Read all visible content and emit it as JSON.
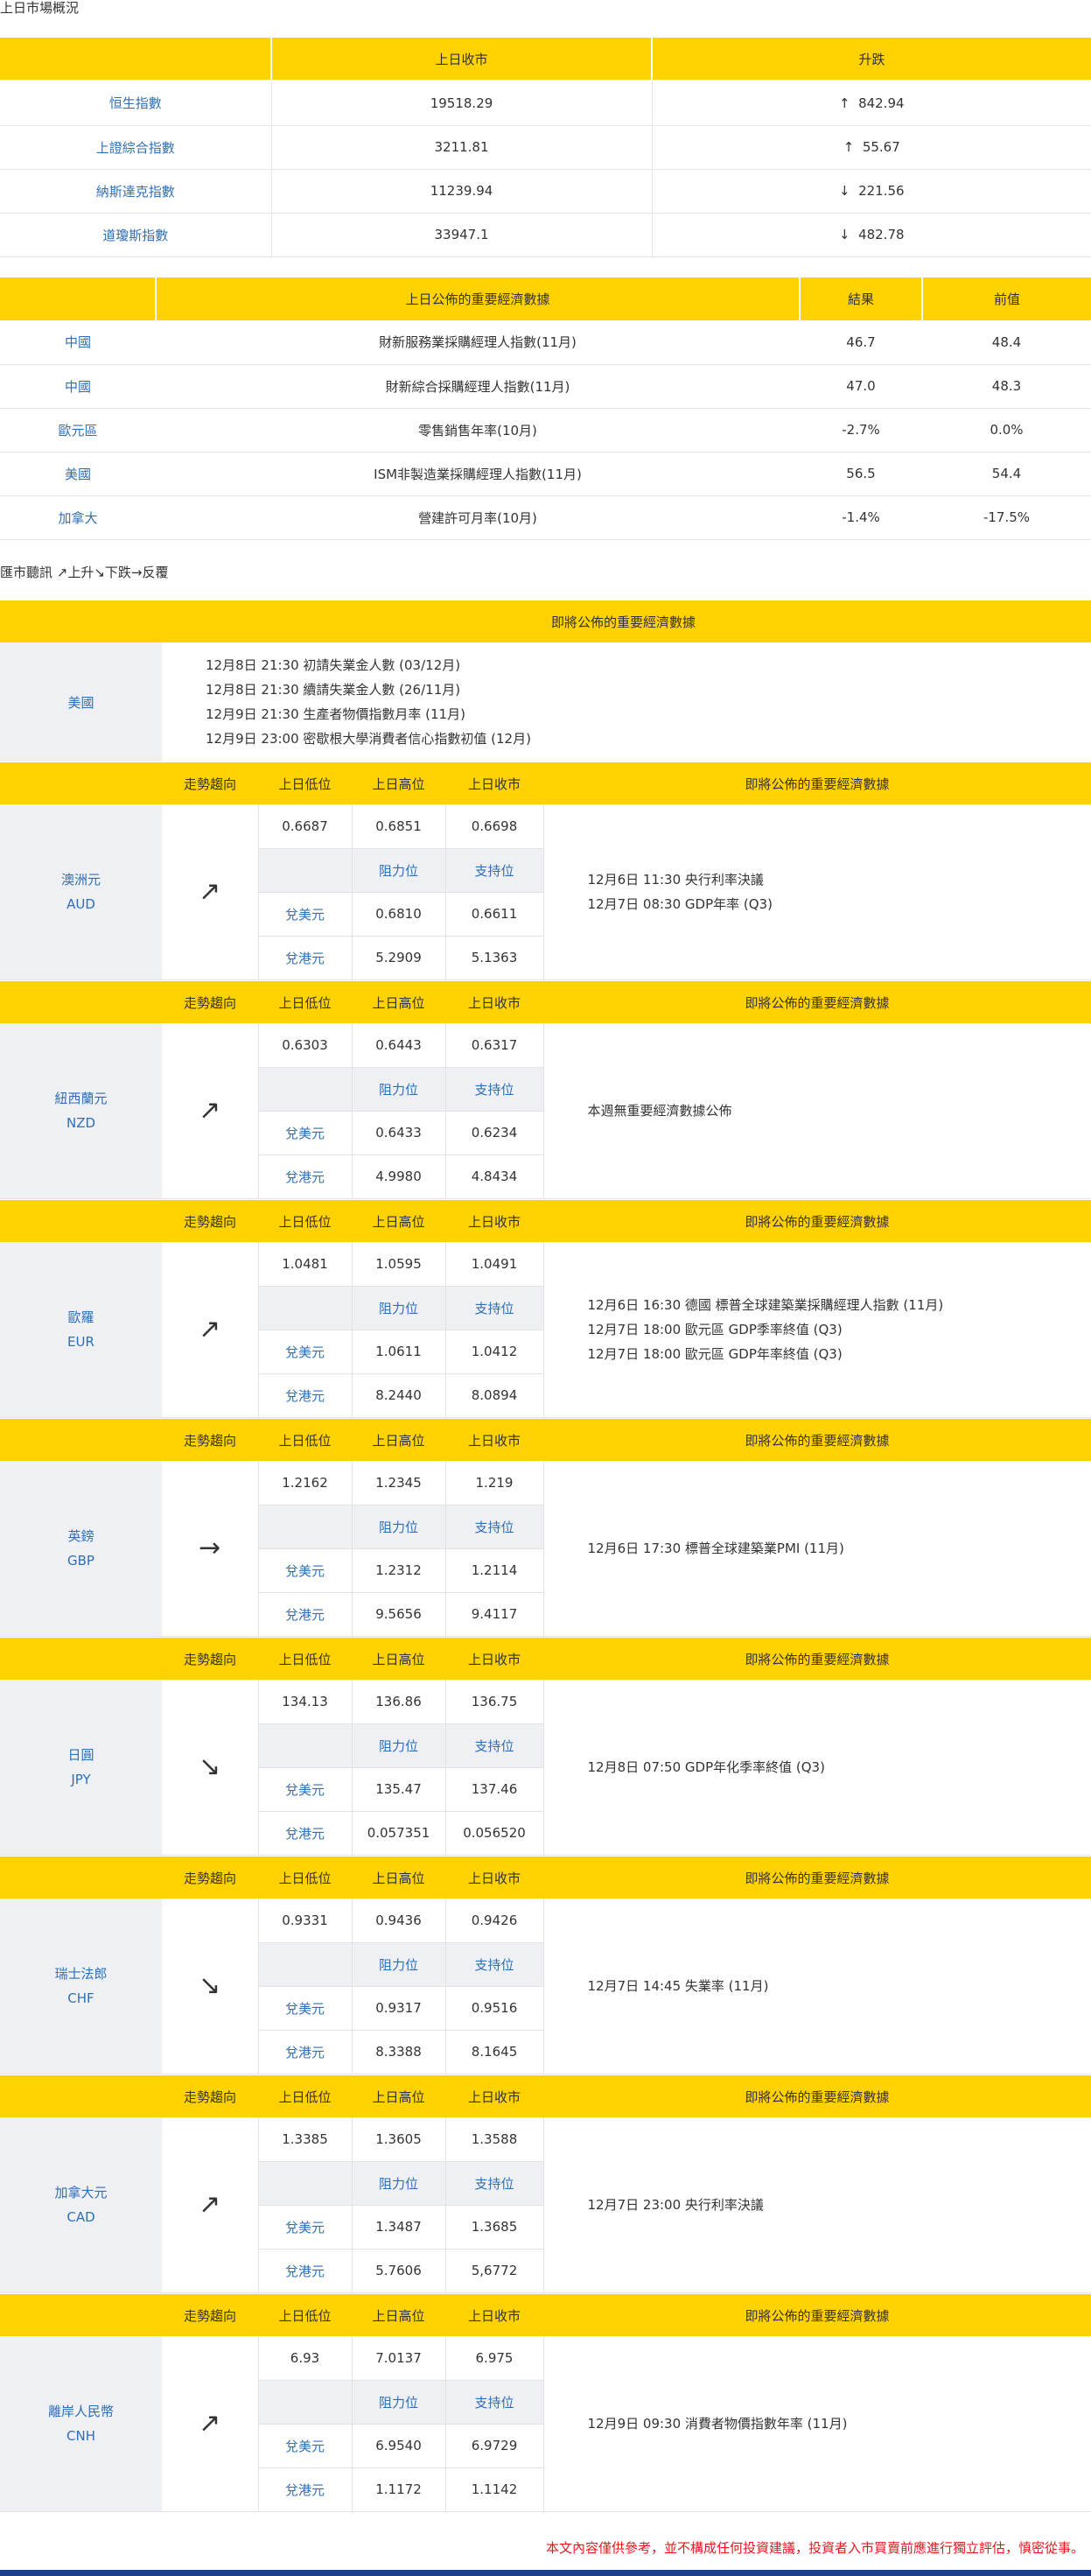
{
  "market_overview": {
    "title": "上日市場概況",
    "headers": [
      "",
      "上日收市",
      "升跌"
    ],
    "rows": [
      {
        "name": "恒生指數",
        "close": "19518.29",
        "arrow": "↑",
        "change": "842.94"
      },
      {
        "name": "上證綜合指數",
        "close": "3211.81",
        "arrow": "↑",
        "change": "55.67"
      },
      {
        "name": "納斯達克指數",
        "close": "11239.94",
        "arrow": "↓",
        "change": "221.56"
      },
      {
        "name": "道瓊斯指數",
        "close": "33947.1",
        "arrow": "↓",
        "change": "482.78"
      }
    ]
  },
  "econ_data": {
    "headers": [
      "",
      "上日公佈的重要經濟數據",
      "結果",
      "前值"
    ],
    "rows": [
      {
        "region": "中國",
        "item": "財新服務業採購經理人指數(11月)",
        "result": "46.7",
        "prev": "48.4"
      },
      {
        "region": "中國",
        "item": "財新綜合採購經理人指數(11月)",
        "result": "47.0",
        "prev": "48.3"
      },
      {
        "region": "歐元區",
        "item": "零售銷售年率(10月)",
        "result": "-2.7%",
        "prev": "0.0%"
      },
      {
        "region": "美國",
        "item": "ISM非製造業採購經理人指數(11月)",
        "result": "56.5",
        "prev": "54.4"
      },
      {
        "region": "加拿大",
        "item": "營建許可月率(10月)",
        "result": "-1.4%",
        "prev": "-17.5%"
      }
    ]
  },
  "fx": {
    "title": "匯市聽訊 ↗上升↘下跌→反覆",
    "upcoming_header": "即將公佈的重要經濟數據",
    "us": {
      "label": "美國",
      "events": [
        "12月8日 21:30  初請失業金人數 (03/12月)",
        "12月8日 21:30  續請失業金人數 (26/11月)",
        "12月9日 21:30  生產者物價指數月率 (11月)",
        "12月9日 23:00  密歇根大學消費者信心指數初值 (12月)"
      ]
    },
    "col_headers": {
      "trend": "走勢趨向",
      "low": "上日低位",
      "high": "上日高位",
      "close": "上日收市",
      "events": "即將公佈的重要經濟數據"
    },
    "sub_headers": {
      "resistance": "阻力位",
      "support": "支持位",
      "usd": "兌美元",
      "hkd": "兌港元"
    },
    "currencies": [
      {
        "name": "澳洲元",
        "code": "AUD",
        "trend": "↗",
        "low": "0.6687",
        "high": "0.6851",
        "close": "0.6698",
        "usd_res": "0.6810",
        "usd_sup": "0.6611",
        "hkd_res": "5.2909",
        "hkd_sup": "5.1363",
        "events": [
          "12月6日 11:30  央行利率決議",
          "12月7日 08:30  GDP年率 (Q3)"
        ]
      },
      {
        "name": "紐西蘭元",
        "code": "NZD",
        "trend": "↗",
        "low": "0.6303",
        "high": "0.6443",
        "close": "0.6317",
        "usd_res": "0.6433",
        "usd_sup": "0.6234",
        "hkd_res": "4.9980",
        "hkd_sup": "4.8434",
        "events": [
          "本週無重要經濟數據公佈"
        ]
      },
      {
        "name": "歐羅",
        "code": "EUR",
        "trend": "↗",
        "low": "1.0481",
        "high": "1.0595",
        "close": "1.0491",
        "usd_res": "1.0611",
        "usd_sup": "1.0412",
        "hkd_res": "8.2440",
        "hkd_sup": "8.0894",
        "events": [
          "12月6日 16:30  德國 標普全球建築業採購經理人指數 (11月)",
          "12月7日 18:00  歐元區 GDP季率終值 (Q3)",
          "12月7日 18:00  歐元區 GDP年率終值 (Q3)"
        ]
      },
      {
        "name": "英鎊",
        "code": "GBP",
        "trend": "→",
        "low": "1.2162",
        "high": "1.2345",
        "close": "1.219",
        "usd_res": "1.2312",
        "usd_sup": "1.2114",
        "hkd_res": "9.5656",
        "hkd_sup": "9.4117",
        "events": [
          "12月6日 17:30  標普全球建築業PMI (11月)"
        ]
      },
      {
        "name": "日圓",
        "code": "JPY",
        "trend": "↘",
        "low": "134.13",
        "high": "136.86",
        "close": "136.75",
        "usd_res": "135.47",
        "usd_sup": "137.46",
        "hkd_res": "0.057351",
        "hkd_sup": "0.056520",
        "events": [
          "12月8日 07:50  GDP年化季率終值 (Q3)"
        ]
      },
      {
        "name": "瑞士法郎",
        "code": "CHF",
        "trend": "↘",
        "low": "0.9331",
        "high": "0.9436",
        "close": "0.9426",
        "usd_res": "0.9317",
        "usd_sup": "0.9516",
        "hkd_res": "8.3388",
        "hkd_sup": "8.1645",
        "events": [
          "12月7日 14:45  失業率 (11月)"
        ]
      },
      {
        "name": "加拿大元",
        "code": "CAD",
        "trend": "↗",
        "low": "1.3385",
        "high": "1.3605",
        "close": "1.3588",
        "usd_res": "1.3487",
        "usd_sup": "1.3685",
        "hkd_res": "5.7606",
        "hkd_sup": "5,6772",
        "events": [
          "12月7日 23:00  央行利率決議"
        ]
      },
      {
        "name": "離岸人民幣",
        "code": "CNH",
        "trend": "↗",
        "low": "6.93",
        "high": "7.0137",
        "close": "6.975",
        "usd_res": "6.9540",
        "usd_sup": "6.9729",
        "hkd_res": "1.1172",
        "hkd_sup": "1.1142",
        "events": [
          "12月9日 09:30  消費者物價指數年率 (11月)"
        ]
      }
    ]
  },
  "footer": {
    "disclaimer": "本文內容僅供參考，並不構成任何投資建議，投資者入市買賣前應進行獨立評估，慎密從事。"
  }
}
